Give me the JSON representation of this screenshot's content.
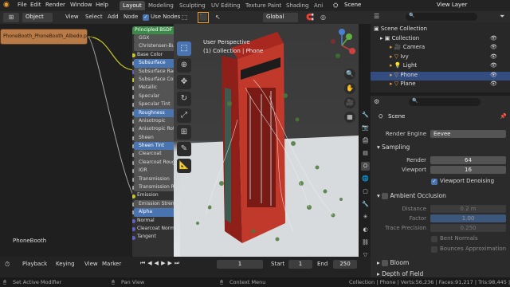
{
  "topbar": {
    "menus": [
      "File",
      "Edit",
      "Render",
      "Window",
      "Help"
    ],
    "workspaces": [
      "Layout",
      "Modeling",
      "Sculpting",
      "UV Editing",
      "Texture Paint",
      "Shading",
      "Ani"
    ],
    "scene": "Scene",
    "view_layer": "View Layer"
  },
  "editor_header": {
    "mode": "Object",
    "menus": [
      "View",
      "Select",
      "Add",
      "Node"
    ],
    "use_nodes_label": "Use Nodes",
    "orientation": "Global"
  },
  "node_editor": {
    "image_node_label": "PhoneBooth_PhoneBooth_Albedo.png",
    "principled_title": "Principled BSDF",
    "rows": [
      {
        "label": "GGX",
        "type": "field"
      },
      {
        "label": "Christensen-Burley",
        "type": "field"
      },
      {
        "label": "Base Color",
        "type": "plain",
        "socket": "y"
      },
      {
        "label": "Subsurface",
        "type": "blue",
        "socket": "g"
      },
      {
        "label": "Subsurface Radius",
        "type": "field",
        "socket": "b"
      },
      {
        "label": "Subsurface Color",
        "type": "field",
        "socket": "y"
      },
      {
        "label": "Metallic",
        "type": "field",
        "socket": "g"
      },
      {
        "label": "Specular",
        "type": "field",
        "socket": "g"
      },
      {
        "label": "Specular Tint",
        "type": "field",
        "socket": "g"
      },
      {
        "label": "Roughness",
        "type": "blue",
        "socket": "g"
      },
      {
        "label": "Anisotropic",
        "type": "field",
        "socket": "g"
      },
      {
        "label": "Anisotropic Rotation",
        "type": "field",
        "socket": "g"
      },
      {
        "label": "Sheen",
        "type": "field",
        "socket": "g"
      },
      {
        "label": "Sheen Tint",
        "type": "blue",
        "socket": "g"
      },
      {
        "label": "Clearcoat",
        "type": "field",
        "socket": "g"
      },
      {
        "label": "Clearcoat Roughness",
        "type": "field",
        "socket": "g"
      },
      {
        "label": "IOR",
        "type": "field",
        "socket": "g"
      },
      {
        "label": "Transmission",
        "type": "field",
        "socket": "g"
      },
      {
        "label": "Transmission Roughness",
        "type": "field",
        "socket": "g"
      },
      {
        "label": "Emission",
        "type": "plain",
        "socket": "y"
      },
      {
        "label": "Emission Strength",
        "type": "field",
        "socket": "g"
      },
      {
        "label": "Alpha",
        "type": "blue",
        "socket": "g"
      },
      {
        "label": "Normal",
        "type": "plain",
        "socket": "b"
      },
      {
        "label": "Clearcoat Normal",
        "type": "plain",
        "socket": "b"
      },
      {
        "label": "Tangent",
        "type": "plain",
        "socket": "b"
      }
    ],
    "material_name": "PhoneBooth"
  },
  "viewport": {
    "view_name": "User Perspective",
    "collection_info": "(1) Collection | Phone"
  },
  "outliner": {
    "scene_collection": "Scene Collection",
    "collection": "Collection",
    "objects": [
      "Camera",
      "Ivy",
      "Light",
      "Phone",
      "Plane"
    ]
  },
  "properties": {
    "scene_label": "Scene",
    "render_engine_label": "Render Engine",
    "render_engine_value": "Eevee",
    "sampling_label": "Sampling",
    "render_label": "Render",
    "render_value": "64",
    "viewport_label": "Viewport",
    "viewport_value": "16",
    "viewport_denoising_label": "Viewport Denoising",
    "ao_label": "Ambient Occlusion",
    "distance_label": "Distance",
    "distance_value": "0.2 m",
    "factor_label": "Factor",
    "factor_value": "1.00",
    "trace_precision_label": "Trace Precision",
    "trace_precision_value": "0.250",
    "bent_normals_label": "Bent Normals",
    "bounces_label": "Bounces Approximation",
    "bloom_label": "Bloom",
    "dof_label": "Depth of Field"
  },
  "timeline": {
    "menus": [
      "Playback",
      "Keying",
      "View",
      "Marker"
    ],
    "current_frame": "1",
    "start_label": "Start",
    "start_value": "1",
    "end_label": "End",
    "end_value": "250"
  },
  "statusbar": {
    "left": "Set Active Modifier",
    "middle": "Pan View",
    "context": "Context Menu",
    "stats": "Collection | Phone | Verts:56,236 | Faces:91,217 | Tris:98,445 | Obje"
  },
  "colors": {
    "accent": "#4a74b0",
    "node_header": "#3c8a47",
    "image_node": "#b87a47",
    "phone_red": "#c0392b"
  }
}
